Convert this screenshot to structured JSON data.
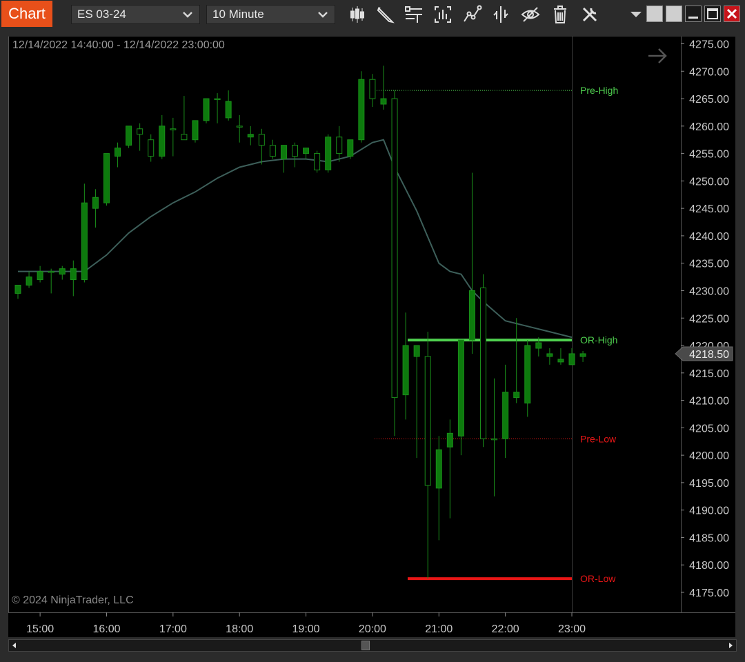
{
  "toolbar": {
    "chart_tab_label": "Chart",
    "instrument": "ES 03-24",
    "interval": "10 Minute",
    "tools": [
      "bar-chart-style-icon",
      "pencil-drawing-icon",
      "horizontal-lines-icon",
      "data-box-icon",
      "strategy-line-icon",
      "split-axis-icon",
      "visibility-eye-icon",
      "trash-icon",
      "wrench-settings-icon"
    ]
  },
  "chart": {
    "date_range": "12/14/2022 14:40:00 - 12/14/2022 23:00:00",
    "copyright": "© 2024 NinjaTrader, LLC",
    "current_price_label": "4218.50"
  },
  "colors": {
    "background": "#000000",
    "candle_up": "#0d7a0d",
    "candle_border": "#1a8f1a",
    "moving_average": "#3d5f5a",
    "pre_high": "#4fd04f",
    "or_high": "#4fd04f",
    "pre_low": "#e81616",
    "or_low": "#e81616"
  },
  "chart_data": {
    "type": "candlestick",
    "symbol": "ES 03-24",
    "interval": "10 Minute",
    "ylim": [
      4172.5,
      4277.5
    ],
    "price_ticks": [
      "4275.00",
      "4270.00",
      "4265.00",
      "4260.00",
      "4255.00",
      "4250.00",
      "4245.00",
      "4240.00",
      "4235.00",
      "4230.00",
      "4225.00",
      "4220.00",
      "4215.00",
      "4210.00",
      "4205.00",
      "4200.00",
      "4195.00",
      "4190.00",
      "4185.00",
      "4180.00",
      "4175.00"
    ],
    "time_ticks": [
      "15:00",
      "16:00",
      "17:00",
      "18:00",
      "19:00",
      "20:00",
      "21:00",
      "22:00",
      "23:00"
    ],
    "time_start_minutes": 880,
    "time_end_minutes": 1380,
    "candles": [
      {
        "t": "14:40",
        "o": 4229.5,
        "h": 4231.0,
        "l": 4228.5,
        "c": 4231.0
      },
      {
        "t": "14:50",
        "o": 4231.0,
        "h": 4233.5,
        "l": 4230.5,
        "c": 4232.5
      },
      {
        "t": "15:00",
        "o": 4232.0,
        "h": 4234.5,
        "l": 4231.5,
        "c": 4233.5
      },
      {
        "t": "15:10",
        "o": 4233.5,
        "h": 4234.0,
        "l": 4229.5,
        "c": 4233.5
      },
      {
        "t": "15:20",
        "o": 4233.0,
        "h": 4234.5,
        "l": 4232.0,
        "c": 4234.0
      },
      {
        "t": "15:30",
        "o": 4232.0,
        "h": 4235.5,
        "l": 4229.0,
        "c": 4234.0
      },
      {
        "t": "15:40",
        "o": 4232.0,
        "h": 4249.5,
        "l": 4231.5,
        "c": 4246.0
      },
      {
        "t": "15:50",
        "o": 4245.0,
        "h": 4248.5,
        "l": 4241.5,
        "c": 4247.0
      },
      {
        "t": "16:00",
        "o": 4246.0,
        "h": 4255.0,
        "l": 4245.5,
        "c": 4255.0
      },
      {
        "t": "16:10",
        "o": 4254.5,
        "h": 4257.0,
        "l": 4252.5,
        "c": 4256.0
      },
      {
        "t": "16:20",
        "o": 4256.5,
        "h": 4260.0,
        "l": 4256.0,
        "c": 4260.0
      },
      {
        "t": "16:30",
        "o": 4259.5,
        "h": 4260.5,
        "l": 4255.5,
        "c": 4258.5
      },
      {
        "t": "16:40",
        "o": 4257.5,
        "h": 4258.5,
        "l": 4253.5,
        "c": 4254.5
      },
      {
        "t": "16:50",
        "o": 4254.5,
        "h": 4262.0,
        "l": 4254.0,
        "c": 4260.0
      },
      {
        "t": "17:00",
        "o": 4259.5,
        "h": 4261.5,
        "l": 4254.5,
        "c": 4259.5
      },
      {
        "t": "17:10",
        "o": 4258.5,
        "h": 4265.5,
        "l": 4257.5,
        "c": 4257.5
      },
      {
        "t": "17:20",
        "o": 4257.5,
        "h": 4261.0,
        "l": 4257.0,
        "c": 4261.0
      },
      {
        "t": "17:30",
        "o": 4261.0,
        "h": 4265.0,
        "l": 4260.5,
        "c": 4265.0
      },
      {
        "t": "17:40",
        "o": 4265.0,
        "h": 4266.0,
        "l": 4260.5,
        "c": 4265.0
      },
      {
        "t": "17:50",
        "o": 4261.5,
        "h": 4266.5,
        "l": 4261.0,
        "c": 4264.5
      },
      {
        "t": "18:00",
        "o": 4260.0,
        "h": 4262.0,
        "l": 4257.0,
        "c": 4260.0
      },
      {
        "t": "18:10",
        "o": 4258.0,
        "h": 4260.0,
        "l": 4256.5,
        "c": 4258.5
      },
      {
        "t": "18:20",
        "o": 4258.5,
        "h": 4259.5,
        "l": 4253.0,
        "c": 4256.5
      },
      {
        "t": "18:30",
        "o": 4256.5,
        "h": 4257.5,
        "l": 4254.0,
        "c": 4254.5
      },
      {
        "t": "18:40",
        "o": 4254.0,
        "h": 4256.5,
        "l": 4251.5,
        "c": 4256.5
      },
      {
        "t": "18:50",
        "o": 4256.5,
        "h": 4257.0,
        "l": 4252.5,
        "c": 4254.5
      },
      {
        "t": "19:00",
        "o": 4255.0,
        "h": 4256.0,
        "l": 4254.0,
        "c": 4256.0
      },
      {
        "t": "19:10",
        "o": 4255.0,
        "h": 4255.5,
        "l": 4251.5,
        "c": 4252.0
      },
      {
        "t": "19:20",
        "o": 4252.0,
        "h": 4258.5,
        "l": 4251.5,
        "c": 4258.0
      },
      {
        "t": "19:30",
        "o": 4258.0,
        "h": 4260.0,
        "l": 4253.5,
        "c": 4255.0
      },
      {
        "t": "19:40",
        "o": 4254.5,
        "h": 4257.5,
        "l": 4254.0,
        "c": 4257.5
      },
      {
        "t": "19:50",
        "o": 4257.5,
        "h": 4270.0,
        "l": 4257.0,
        "c": 4268.5
      },
      {
        "t": "20:00",
        "o": 4268.5,
        "h": 4269.5,
        "l": 4263.5,
        "c": 4265.0
      },
      {
        "t": "20:10",
        "o": 4264.0,
        "h": 4271.0,
        "l": 4263.0,
        "c": 4265.0
      },
      {
        "t": "20:20",
        "o": 4265.0,
        "h": 4266.5,
        "l": 4203.5,
        "c": 4210.5
      },
      {
        "t": "20:30",
        "o": 4211.0,
        "h": 4226.0,
        "l": 4206.5,
        "c": 4220.0
      },
      {
        "t": "20:40",
        "o": 4218.0,
        "h": 4220.0,
        "l": 4199.5,
        "c": 4220.0
      },
      {
        "t": "20:50",
        "o": 4218.0,
        "h": 4222.5,
        "l": 4177.5,
        "c": 4194.5
      },
      {
        "t": "21:00",
        "o": 4194.0,
        "h": 4203.5,
        "l": 4184.5,
        "c": 4201.0
      },
      {
        "t": "21:10",
        "o": 4201.5,
        "h": 4206.5,
        "l": 4188.5,
        "c": 4204.0
      },
      {
        "t": "21:20",
        "o": 4203.5,
        "h": 4221.0,
        "l": 4200.0,
        "c": 4221.0
      },
      {
        "t": "21:30",
        "o": 4221.0,
        "h": 4251.5,
        "l": 4218.5,
        "c": 4230.0
      },
      {
        "t": "21:40",
        "o": 4230.5,
        "h": 4233.0,
        "l": 4201.5,
        "c": 4203.0
      },
      {
        "t": "21:50",
        "o": 4203.0,
        "h": 4214.0,
        "l": 4192.5,
        "c": 4203.0
      },
      {
        "t": "22:00",
        "o": 4203.0,
        "h": 4216.5,
        "l": 4199.5,
        "c": 4211.5
      },
      {
        "t": "22:10",
        "o": 4210.5,
        "h": 4225.0,
        "l": 4209.5,
        "c": 4211.5
      },
      {
        "t": "22:20",
        "o": 4209.5,
        "h": 4221.0,
        "l": 4207.0,
        "c": 4220.0
      },
      {
        "t": "22:30",
        "o": 4219.5,
        "h": 4221.5,
        "l": 4218.0,
        "c": 4220.5
      },
      {
        "t": "22:40",
        "o": 4218.0,
        "h": 4219.5,
        "l": 4216.5,
        "c": 4218.5
      },
      {
        "t": "22:50",
        "o": 4217.0,
        "h": 4219.5,
        "l": 4216.5,
        "c": 4217.5
      },
      {
        "t": "23:00",
        "o": 4216.5,
        "h": 4219.5,
        "l": 4216.5,
        "c": 4218.5
      },
      {
        "t": "23:10",
        "o": 4218.0,
        "h": 4219.0,
        "l": 4217.0,
        "c": 4218.5
      }
    ],
    "moving_average": [
      {
        "t": "14:40",
        "v": 4233.5
      },
      {
        "t": "15:00",
        "v": 4233.5
      },
      {
        "t": "15:20",
        "v": 4233.5
      },
      {
        "t": "15:40",
        "v": 4233.5
      },
      {
        "t": "16:00",
        "v": 4236.5
      },
      {
        "t": "16:20",
        "v": 4240.5
      },
      {
        "t": "16:40",
        "v": 4243.5
      },
      {
        "t": "17:00",
        "v": 4246.0
      },
      {
        "t": "17:20",
        "v": 4248.0
      },
      {
        "t": "17:40",
        "v": 4250.5
      },
      {
        "t": "18:00",
        "v": 4252.5
      },
      {
        "t": "18:20",
        "v": 4253.5
      },
      {
        "t": "18:40",
        "v": 4254.0
      },
      {
        "t": "19:00",
        "v": 4254.0
      },
      {
        "t": "19:20",
        "v": 4253.5
      },
      {
        "t": "19:40",
        "v": 4254.5
      },
      {
        "t": "20:00",
        "v": 4257.0
      },
      {
        "t": "20:10",
        "v": 4257.5
      },
      {
        "t": "20:20",
        "v": 4252.5
      },
      {
        "t": "20:40",
        "v": 4244.5
      },
      {
        "t": "21:00",
        "v": 4235.0
      },
      {
        "t": "21:10",
        "v": 4233.5
      },
      {
        "t": "21:20",
        "v": 4233.0
      },
      {
        "t": "21:30",
        "v": 4230.0
      },
      {
        "t": "21:40",
        "v": 4228.0
      },
      {
        "t": "22:00",
        "v": 4224.5
      },
      {
        "t": "22:20",
        "v": 4223.5
      },
      {
        "t": "22:40",
        "v": 4222.5
      },
      {
        "t": "23:00",
        "v": 4221.5
      }
    ],
    "levels": [
      {
        "name": "Pre-High",
        "value": 4266.5,
        "from": "20:00",
        "to": "23:00",
        "style": "dotted",
        "color": "#4fd04f"
      },
      {
        "name": "OR-High",
        "value": 4221.0,
        "from": "20:50",
        "to": "23:00",
        "style": "thick",
        "color": "#4fd04f"
      },
      {
        "name": "Pre-Low",
        "value": 4203.0,
        "from": "20:00",
        "to": "23:00",
        "style": "dotted",
        "color": "#e81616"
      },
      {
        "name": "OR-Low",
        "value": 4177.5,
        "from": "20:50",
        "to": "23:00",
        "style": "thick",
        "color": "#e81616"
      }
    ],
    "current_price": 4218.5
  }
}
